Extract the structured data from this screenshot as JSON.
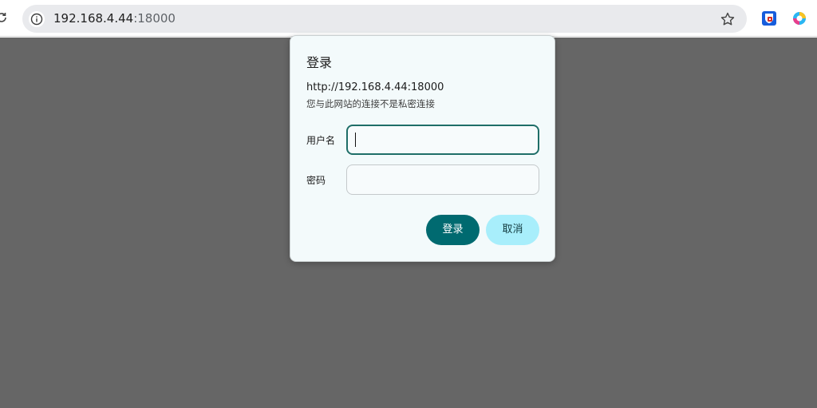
{
  "browser": {
    "url_host": "192.168.4.44",
    "url_port": ":18000"
  },
  "icons": {
    "reload": "reload-icon",
    "site_info": "info-circle-icon",
    "bookmark": "star-icon",
    "extension_1": "bitwarden-icon",
    "extension_2": "edge-copilot-icon"
  },
  "dialog": {
    "title": "登录",
    "origin": "http://192.168.4.44:18000",
    "warning": "您与此网站的连接不是私密连接",
    "username_label": "用户名",
    "username_value": "",
    "password_label": "密码",
    "password_value": "",
    "login_button": "登录",
    "cancel_button": "取消"
  },
  "colors": {
    "overlay": "#666666",
    "dialog_background": "#f3fafb",
    "focused_border": "#1f6e68",
    "primary_button": "#006a70",
    "secondary_button": "#a8eefb"
  }
}
